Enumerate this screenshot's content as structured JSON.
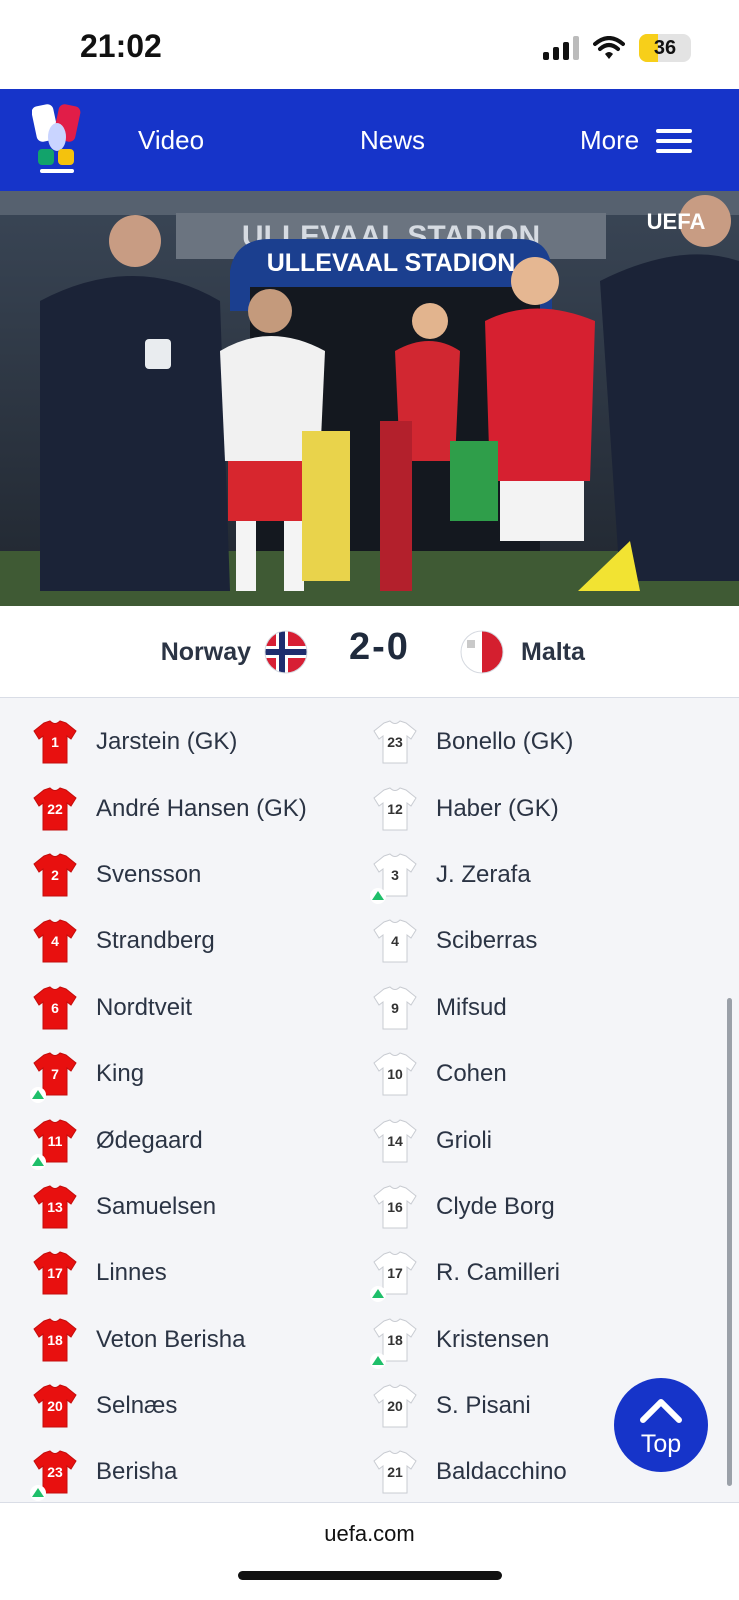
{
  "status_bar": {
    "time": "21:02",
    "battery": "36",
    "battery_level": 0.36
  },
  "nav": {
    "logo_icon": "uefa-euro-2028-logo",
    "items": [
      {
        "label": "Video"
      },
      {
        "label": "News"
      },
      {
        "label": "More"
      }
    ],
    "menu_icon": "hamburger-icon"
  },
  "video": {
    "banner_text": "ULLEVAAL STADION",
    "sign_text": "ULLEVAAL STADION",
    "watermark": "UEFA"
  },
  "match": {
    "home_team": "Norway",
    "away_team": "Malta",
    "score": "2-0",
    "home_flag": "norway-flag-icon",
    "away_flag": "malta-flag-icon"
  },
  "lineup": {
    "home_shirt_color": "#e8100f",
    "away_shirt_color": "#ffffff",
    "sub_marker_color": "#1fbf6a",
    "home": [
      {
        "number": "1",
        "name": "Jarstein (GK)",
        "sub": false
      },
      {
        "number": "22",
        "name": "André Hansen (GK)",
        "sub": false
      },
      {
        "number": "2",
        "name": "Svensson",
        "sub": false
      },
      {
        "number": "4",
        "name": "Strandberg",
        "sub": false
      },
      {
        "number": "6",
        "name": "Nordtveit",
        "sub": false
      },
      {
        "number": "7",
        "name": "King",
        "sub": true
      },
      {
        "number": "11",
        "name": "Ødegaard",
        "sub": true
      },
      {
        "number": "13",
        "name": "Samuelsen",
        "sub": false
      },
      {
        "number": "17",
        "name": "Linnes",
        "sub": false
      },
      {
        "number": "18",
        "name": "Veton Berisha",
        "sub": false
      },
      {
        "number": "20",
        "name": "Selnæs",
        "sub": false
      },
      {
        "number": "23",
        "name": "Berisha",
        "sub": true
      }
    ],
    "away": [
      {
        "number": "23",
        "name": "Bonello (GK)",
        "sub": false
      },
      {
        "number": "12",
        "name": "Haber (GK)",
        "sub": false
      },
      {
        "number": "3",
        "name": "J. Zerafa",
        "sub": true
      },
      {
        "number": "4",
        "name": "Sciberras",
        "sub": false
      },
      {
        "number": "9",
        "name": "Mifsud",
        "sub": false
      },
      {
        "number": "10",
        "name": "Cohen",
        "sub": false
      },
      {
        "number": "14",
        "name": "Grioli",
        "sub": false
      },
      {
        "number": "16",
        "name": "Clyde Borg",
        "sub": false
      },
      {
        "number": "17",
        "name": "R. Camilleri",
        "sub": true
      },
      {
        "number": "18",
        "name": "Kristensen",
        "sub": true
      },
      {
        "number": "20",
        "name": "S. Pisani",
        "sub": false
      },
      {
        "number": "21",
        "name": "Baldacchino",
        "sub": false
      }
    ]
  },
  "top_button": {
    "label": "Top",
    "icon": "chevron-up-icon"
  },
  "footer": {
    "url": "uefa.com"
  }
}
